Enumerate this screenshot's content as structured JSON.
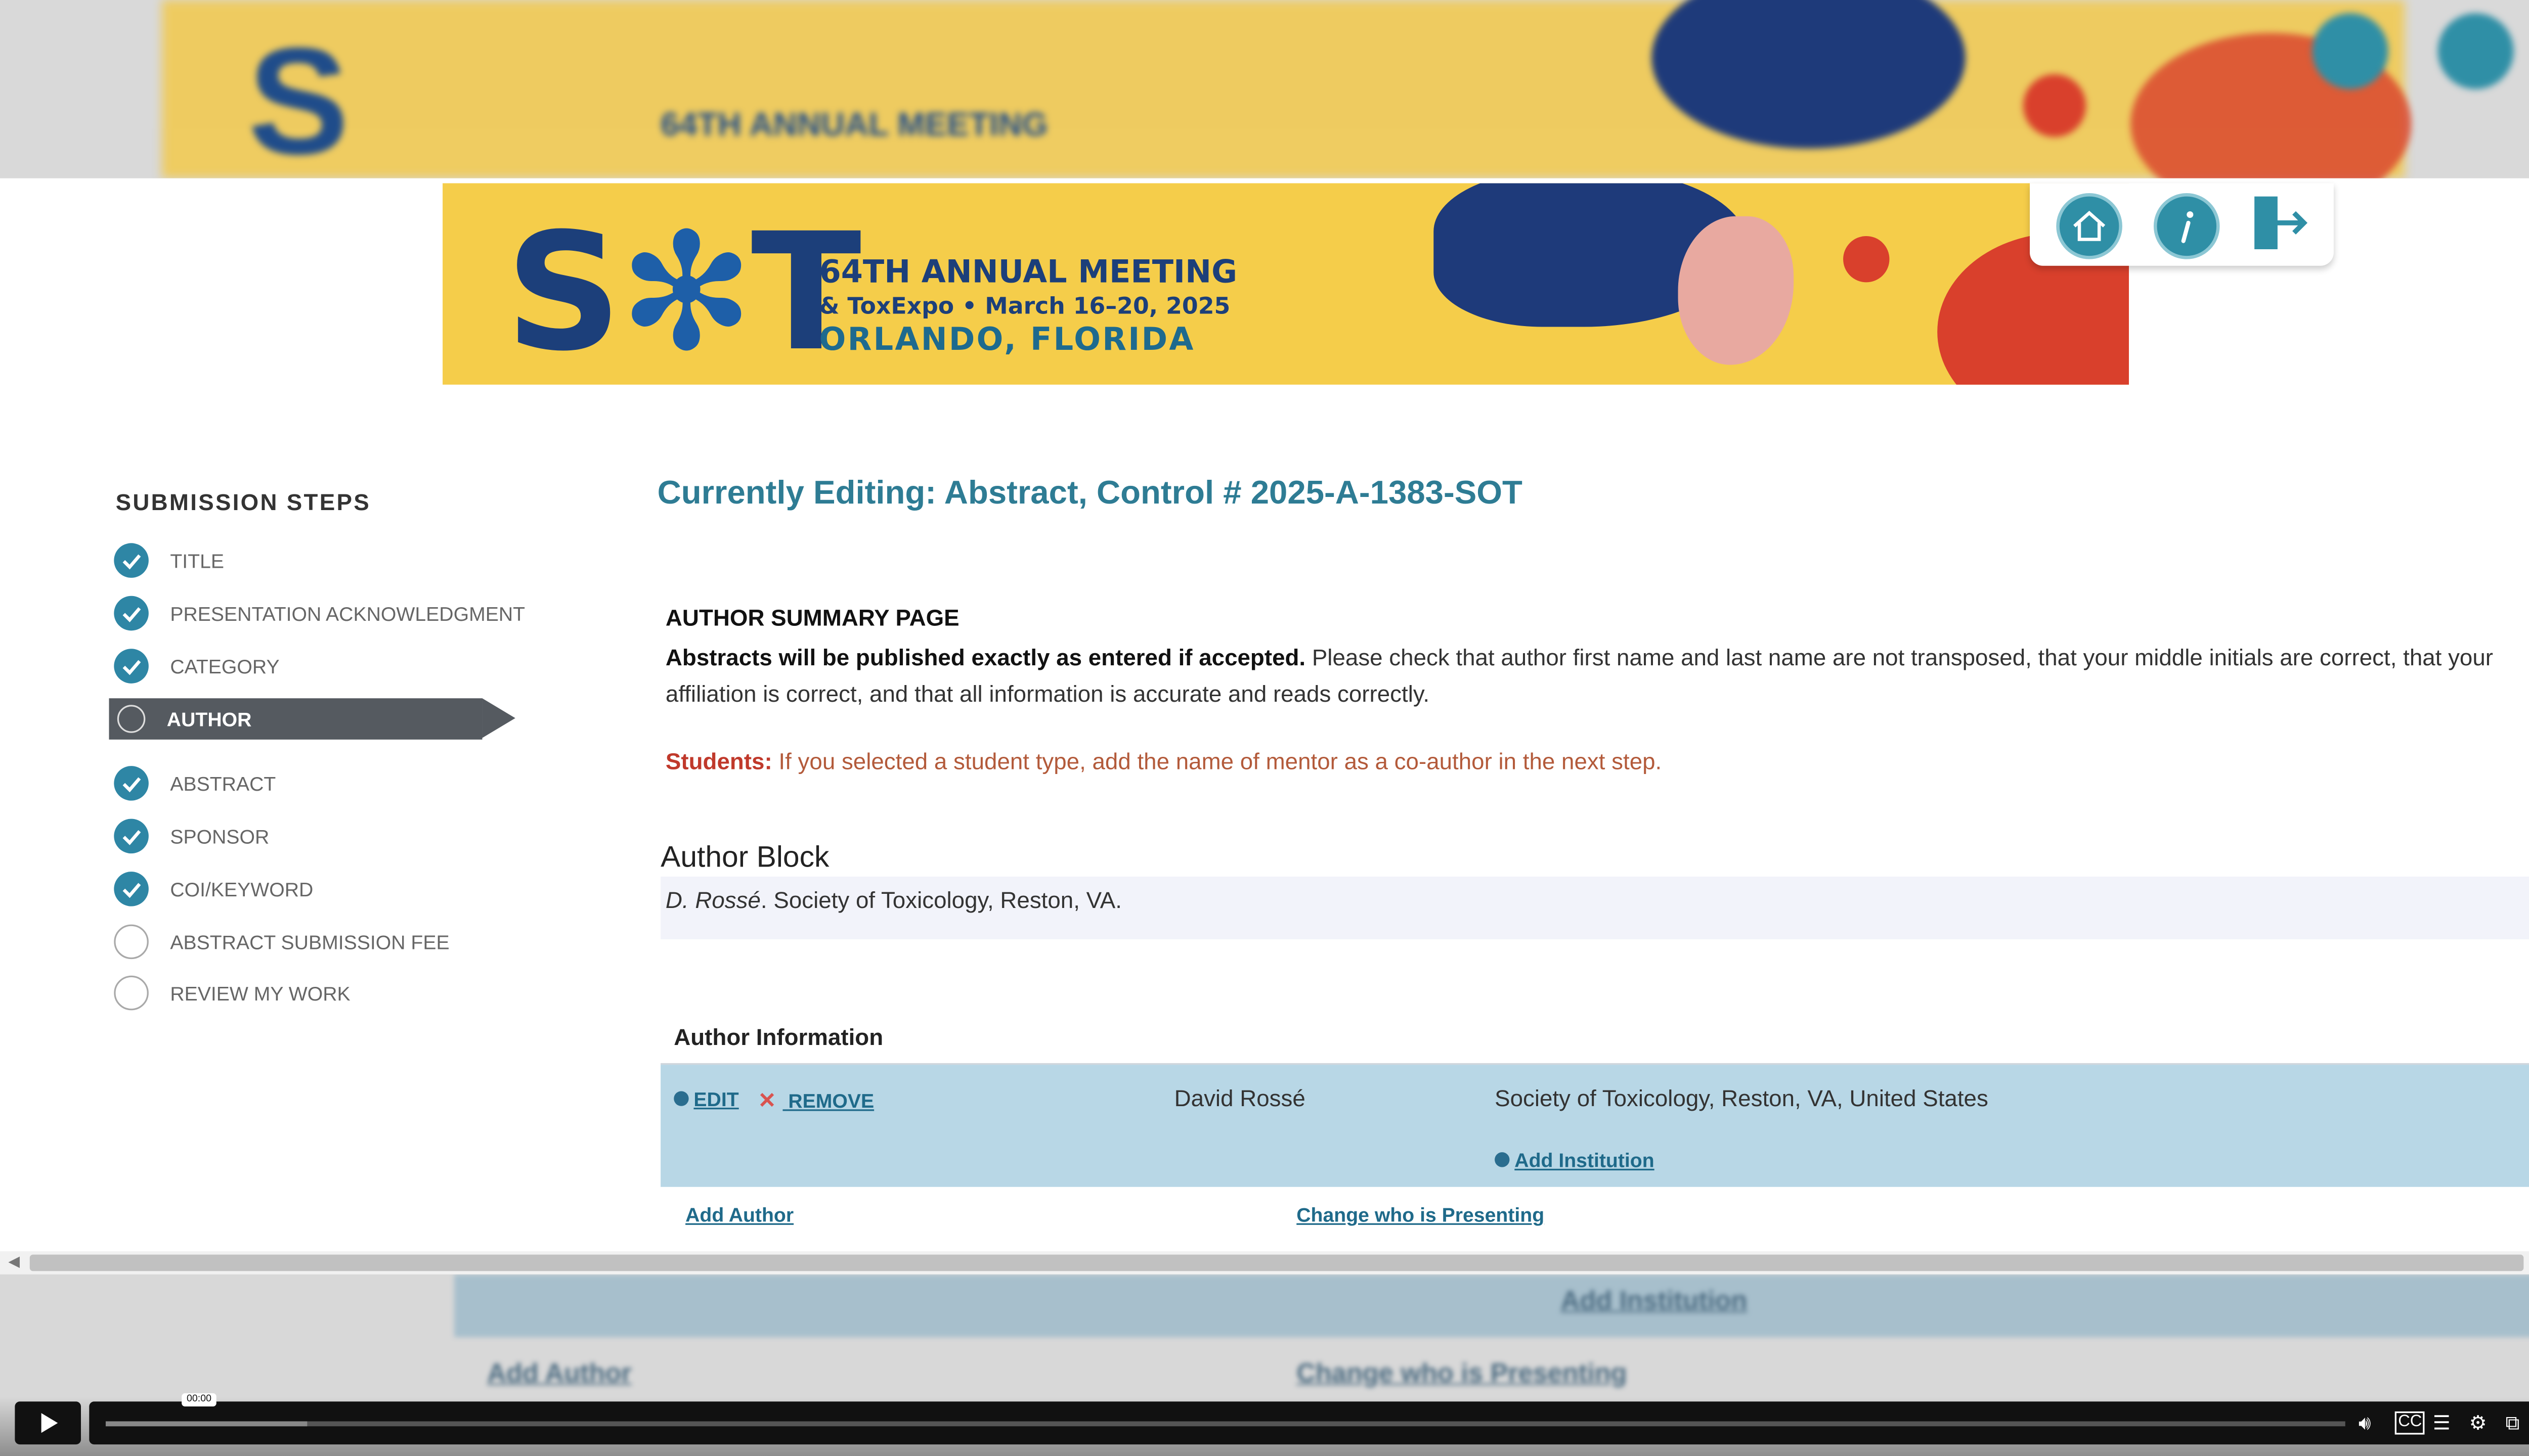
{
  "banner": {
    "logo_s": "S",
    "logo_star": "✻",
    "logo_t": "T",
    "meeting_line1": "64TH ANNUAL MEETING",
    "meeting_line2": "& ToxExpo • March 16–20, 2025",
    "meeting_line3": "ORLANDO, FLORIDA"
  },
  "sidebar": {
    "title": "SUBMISSION STEPS",
    "steps": [
      {
        "label": "TITLE",
        "status": "complete"
      },
      {
        "label": "PRESENTATION ACKNOWLEDGMENT",
        "status": "complete"
      },
      {
        "label": "CATEGORY",
        "status": "complete"
      },
      {
        "label": "AUTHOR",
        "status": "current"
      },
      {
        "label": "ABSTRACT",
        "status": "complete"
      },
      {
        "label": "SPONSOR",
        "status": "complete"
      },
      {
        "label": "COI/KEYWORD",
        "status": "complete"
      },
      {
        "label": "ABSTRACT SUBMISSION FEE",
        "status": "incomplete"
      },
      {
        "label": "REVIEW MY WORK",
        "status": "incomplete"
      }
    ]
  },
  "main": {
    "heading": "Currently Editing: Abstract,  Control # 2025-A-1383-SOT",
    "summary_title": "AUTHOR SUMMARY PAGE",
    "summary_bold": "Abstracts will be published exactly as entered if accepted.",
    "summary_text": " Please check that author first name and last name are not transposed, that your middle initials are correct, that your affiliation is correct, and that all information is accurate and reads correctly.",
    "students_label": "Students:",
    "students_text": " If you selected a student type, add the name of mentor as a co-author in the next step.",
    "author_block_title": "Author Block",
    "author_block_name": "D. Rossé",
    "author_block_rest": ". Society of Toxicology, Reston, VA.",
    "author_info_title": "Author Information",
    "author_row": {
      "edit_label": "EDIT",
      "remove_label": " REMOVE",
      "name": "David Rossé",
      "institution": "Society of Toxicology, Reston, VA, United States",
      "add_institution_label": "Add Institution"
    },
    "add_author_label": "Add Author",
    "change_presenting_label": "Change who is Presenting"
  },
  "player": {
    "timecode": "00:00",
    "progress": 0.0
  },
  "colors": {
    "accent": "#2e7c94",
    "banner_yellow": "#f5cd4a",
    "active_step": "#555a60",
    "author_row": "#b8d7e6",
    "students_red": "#c0392b"
  },
  "icons": {
    "nav": [
      "home-icon",
      "info-icon",
      "logout-icon"
    ],
    "step_complete": "check-circle-icon",
    "step_incomplete": "empty-circle-icon"
  }
}
